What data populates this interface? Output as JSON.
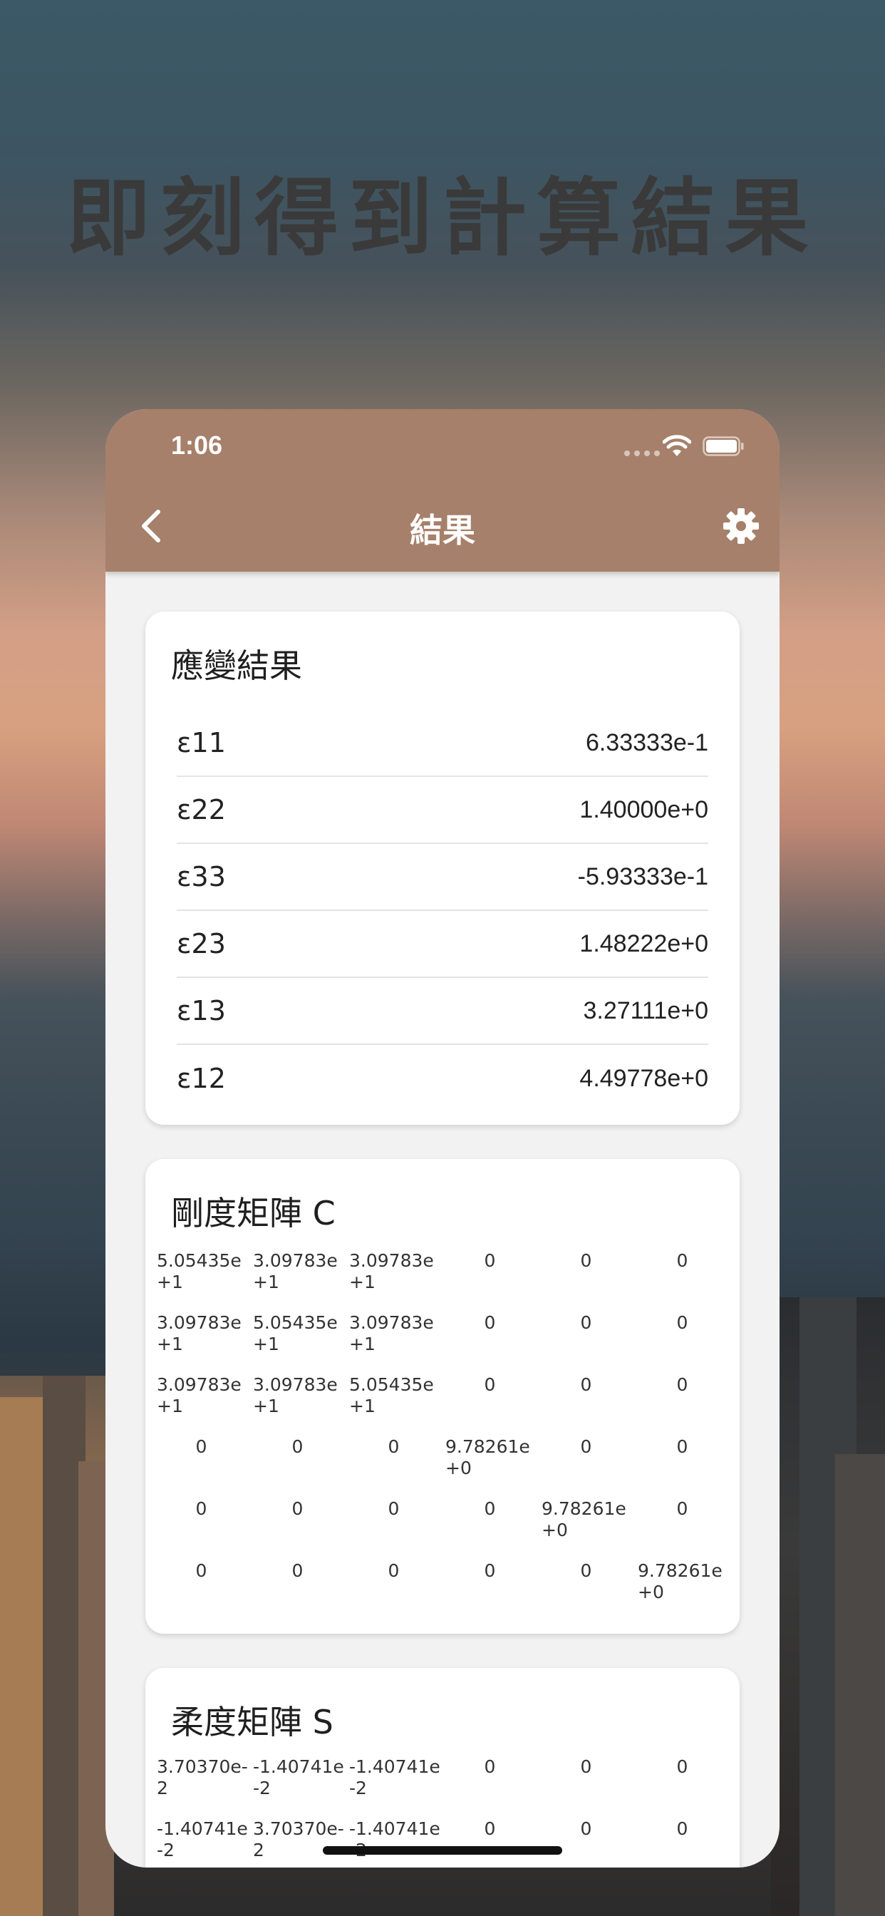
{
  "headline": "即刻得到計算結果",
  "status_bar": {
    "time": "1:06",
    "wifi_icon": "wifi-icon",
    "battery_icon": "battery-icon"
  },
  "nav": {
    "title": "結果",
    "back_icon": "chevron-left-icon",
    "settings_icon": "gear-icon"
  },
  "colors": {
    "nav_bar": "#a6806a",
    "background": "#f2f2f2",
    "card": "#ffffff"
  },
  "strain_card": {
    "title": "應變結果",
    "rows": [
      {
        "label": "ε11",
        "value": "6.33333e-1"
      },
      {
        "label": "ε22",
        "value": "1.40000e+0"
      },
      {
        "label": "ε33",
        "value": "-5.93333e-1"
      },
      {
        "label": "ε23",
        "value": "1.48222e+0"
      },
      {
        "label": "ε13",
        "value": "3.27111e+0"
      },
      {
        "label": "ε12",
        "value": "4.49778e+0"
      }
    ]
  },
  "stiffness_card": {
    "title": "剛度矩陣 C",
    "rows": [
      [
        "5.05435e+1",
        "3.09783e+1",
        "3.09783e+1",
        "0",
        "0",
        "0"
      ],
      [
        "3.09783e+1",
        "5.05435e+1",
        "3.09783e+1",
        "0",
        "0",
        "0"
      ],
      [
        "3.09783e+1",
        "3.09783e+1",
        "5.05435e+1",
        "0",
        "0",
        "0"
      ],
      [
        "0",
        "0",
        "0",
        "9.78261e+0",
        "0",
        "0"
      ],
      [
        "0",
        "0",
        "0",
        "0",
        "9.78261e+0",
        "0"
      ],
      [
        "0",
        "0",
        "0",
        "0",
        "0",
        "9.78261e+0"
      ]
    ]
  },
  "compliance_card": {
    "title": "柔度矩陣 S",
    "rows": [
      [
        "3.70370e-2",
        "-1.40741e-2",
        "-1.40741e-2",
        "0",
        "0",
        "0"
      ],
      [
        "-1.40741e-2",
        "3.70370e-2",
        "-1.40741e-2",
        "0",
        "0",
        "0"
      ]
    ]
  }
}
